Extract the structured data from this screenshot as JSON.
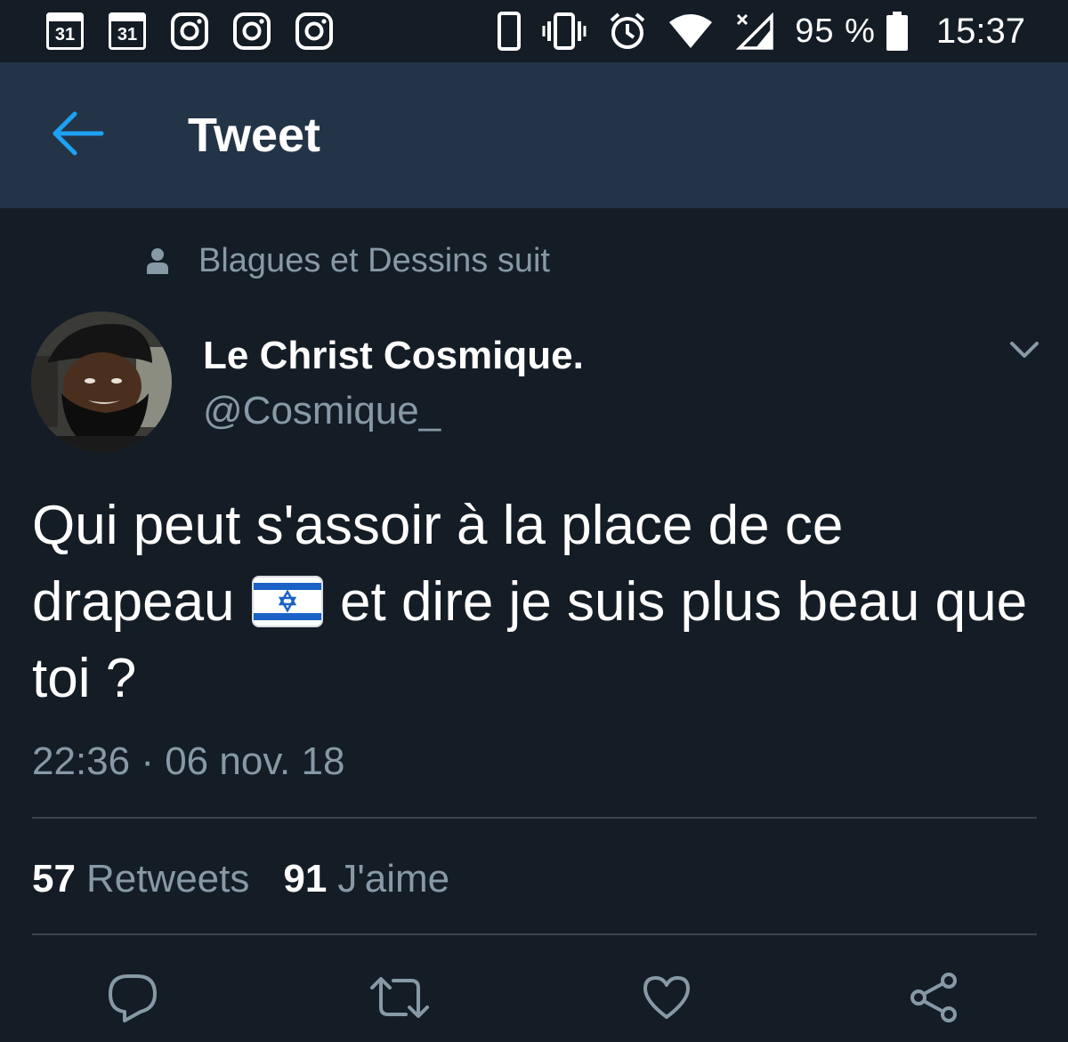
{
  "status_bar": {
    "calendar_day_1": "31",
    "calendar_day_2": "31",
    "notification_icons": [
      "calendar-icon",
      "calendar-icon",
      "instagram-icon",
      "instagram-icon",
      "instagram-icon"
    ],
    "system_icons": [
      "phone-icon",
      "vibrate-icon",
      "alarm-icon",
      "wifi-icon",
      "cellular-signal-icon",
      "battery-icon"
    ],
    "battery_percent": "95 %",
    "time": "15:37"
  },
  "header": {
    "back_icon": "arrow-left-icon",
    "title": "Tweet"
  },
  "tweet": {
    "social_context": "Blagues et Dessins suit",
    "display_name": "Le Christ Cosmique.",
    "handle": "@Cosmique_",
    "text_part_1": "Qui peut s'assoir à la place de ce drapeau",
    "text_part_2": "et dire je suis plus beau que toi ?",
    "timestamp": "22:36 · 06 nov. 18",
    "retweets_count": "57",
    "retweets_label": "Retweets",
    "likes_count": "91",
    "likes_label": "J'aime"
  },
  "actions": [
    "reply-icon",
    "retweet-icon",
    "like-icon",
    "share-icon"
  ],
  "colors": {
    "background": "#141d26",
    "header": "#243447",
    "accent": "#1da1f2",
    "secondary_text": "#8899a6",
    "divider": "#38444d"
  }
}
